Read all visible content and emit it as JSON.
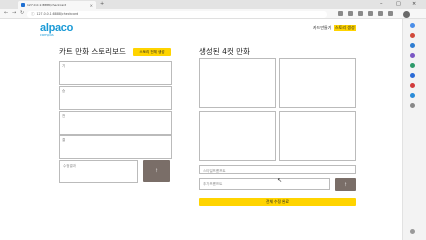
{
  "browser": {
    "tab_title": "127.0.0.1:8888/checkcard",
    "url": "127.0.0.1:8888/checkcard"
  },
  "app": {
    "logo": "alpaco",
    "logo_sub": "campus",
    "nav": [
      "카드만들기",
      "스토리 생성"
    ]
  },
  "left": {
    "title": "카트 만화 스토리보드",
    "story_button": "스토리 전체 생성",
    "scenes": [
      "기",
      "승",
      "전",
      "결"
    ],
    "modify_placeholder": "수정결과",
    "send_icon": "↑"
  },
  "right": {
    "title": "생성된 4컷 만화",
    "style_placeholder": "스타일프롬프트",
    "extra_placeholder": "추가프롬프트",
    "send_icon": "↑",
    "done_button": "전체 수정 완료"
  }
}
